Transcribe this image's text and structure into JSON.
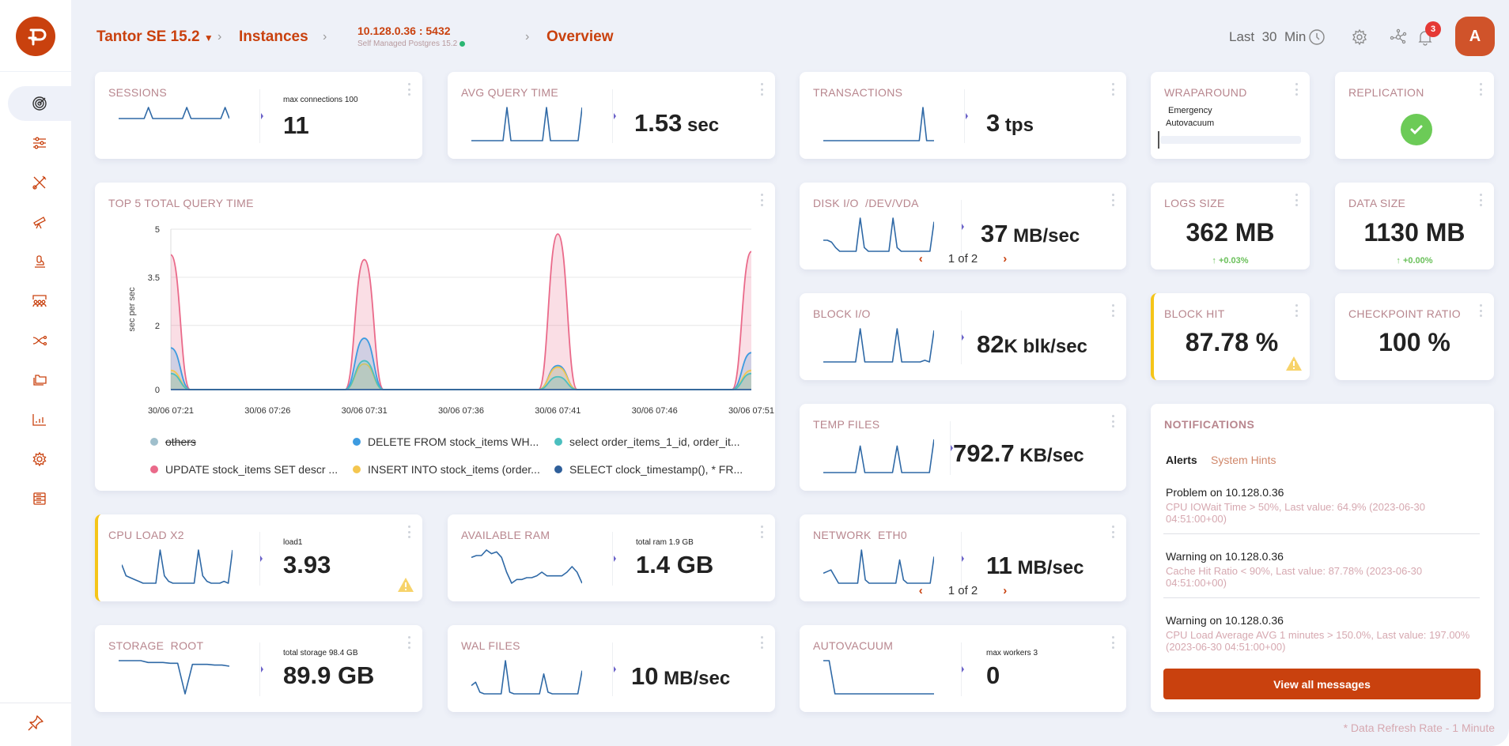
{
  "brand": {
    "logo": "tantor-logo",
    "color": "#C9410E"
  },
  "sidebar": {
    "items": [
      {
        "name": "overview",
        "icon": "radar-icon",
        "active": true
      },
      {
        "name": "configuration",
        "icon": "sliders-icon"
      },
      {
        "name": "tools",
        "icon": "tools-icon"
      },
      {
        "name": "monitoring",
        "icon": "telescope-icon"
      },
      {
        "name": "inspector",
        "icon": "microscope-icon"
      },
      {
        "name": "sessions",
        "icon": "users-icon"
      },
      {
        "name": "replication",
        "icon": "shuffle-icon"
      },
      {
        "name": "storage",
        "icon": "folder-icon"
      },
      {
        "name": "statistics",
        "icon": "bar-chart-icon"
      },
      {
        "name": "settings",
        "icon": "gear-icon"
      },
      {
        "name": "database",
        "icon": "database-icon"
      }
    ],
    "pin_icon": "pin-icon"
  },
  "header": {
    "product": "Tantor SE 15.2",
    "instances": "Instances",
    "instance_ip": "10.128.0.36 : 5432",
    "instance_sub": "Self Managed Postgres 15.2",
    "page": "Overview",
    "time_range_prefix": "Last",
    "time_range_value": "30",
    "time_range_unit": "Min",
    "notifications_count": "3",
    "avatar_initial": "A"
  },
  "cards": {
    "sessions": {
      "title": "SESSIONS",
      "sub": "max connections 100",
      "value": "11",
      "unit": ""
    },
    "avg_query": {
      "title": "AVG QUERY TIME",
      "value": "1.53",
      "unit": " sec"
    },
    "transactions": {
      "title": "TRANSACTIONS",
      "value": "3",
      "unit": " tps"
    },
    "wraparound": {
      "title": "WRAPAROUND",
      "label1": "Emergency",
      "label2": "Autovacuum",
      "progress": 0
    },
    "replication": {
      "title": "REPLICATION",
      "status": "ok"
    },
    "disk_io": {
      "title": "DISK I/O  /DEV/VDA",
      "value": "37",
      "unit": " MB/sec",
      "pager": "1 of 2"
    },
    "logs_size": {
      "title": "LOGS SIZE",
      "value": "362 MB",
      "delta": "↑  +0.03%"
    },
    "data_size": {
      "title": "DATA SIZE",
      "value": "1130 MB",
      "delta": "↑  +0.00%"
    },
    "block_io": {
      "title": "BLOCK I/O",
      "value": "82",
      "unit_k": "K",
      "unit": " blk/sec"
    },
    "block_hit": {
      "title": "BLOCK HIT",
      "value": "87.78 %",
      "warning": true
    },
    "checkpoint": {
      "title": "CHECKPOINT RATIO",
      "value": "100 %"
    },
    "temp_files": {
      "title": "TEMP FILES",
      "value": "792.7",
      "unit": " KB/sec"
    },
    "cpu_load": {
      "title": "CPU LOAD X2",
      "sub": "load1",
      "value": "3.93",
      "warning": true
    },
    "ram": {
      "title": "AVAILABLE RAM",
      "sub": "total ram 1.9 GB",
      "value": "1.4 GB"
    },
    "network": {
      "title": "NETWORK  ETH0",
      "value": "11",
      "unit": " MB/sec",
      "pager": "1 of 2"
    },
    "storage": {
      "title": "STORAGE  ROOT",
      "sub": "total storage 98.4 GB",
      "value": "89.9 GB"
    },
    "wal": {
      "title": "WAL FILES",
      "value": "10",
      "unit": " MB/sec"
    },
    "autovacuum": {
      "title": "AUTOVACUUM",
      "sub": "max workers 3",
      "value": "0"
    }
  },
  "pager_prev": "‹",
  "pager_next": "›",
  "sparklines": {
    "sessions": [
      4,
      4,
      4,
      4,
      4,
      4,
      4,
      6,
      4,
      4,
      4,
      4,
      4,
      4,
      4,
      4,
      6,
      4,
      4,
      4,
      4,
      4,
      4,
      4,
      4,
      6,
      4
    ],
    "avg_query": [
      0,
      0,
      0,
      0,
      0,
      0,
      0,
      0,
      0,
      10,
      0,
      0,
      0,
      0,
      0,
      0,
      0,
      0,
      0,
      10,
      0,
      0,
      0,
      0,
      0,
      0,
      0,
      0,
      10
    ],
    "transactions": [
      0,
      0,
      0,
      0,
      0,
      0,
      0,
      0,
      0,
      0,
      0,
      0,
      0,
      0,
      0,
      0,
      0,
      0,
      0,
      0,
      0,
      0,
      0,
      0,
      0,
      0,
      0,
      10,
      0,
      0,
      0
    ],
    "disk_io": [
      3,
      3,
      2.5,
      1,
      0,
      0,
      0,
      0,
      0,
      9,
      1,
      0,
      0,
      0,
      0,
      0,
      0,
      9,
      1,
      0,
      0,
      0,
      0,
      0,
      0,
      0,
      0,
      8
    ],
    "block_io": [
      0,
      0,
      0,
      0,
      0,
      0,
      0,
      0,
      10,
      0,
      0,
      0,
      0,
      0,
      0,
      0,
      10,
      0,
      0,
      0,
      0,
      0,
      0.5,
      0,
      9.5
    ],
    "temp_files": [
      0,
      0,
      0,
      0,
      0,
      0,
      0,
      0,
      8,
      0,
      0,
      0,
      0,
      0,
      0,
      0,
      8,
      0,
      0,
      0,
      0,
      0,
      0,
      0,
      10
    ],
    "cpu_load": [
      5,
      2,
      1.5,
      1,
      0.5,
      0,
      0,
      0,
      0,
      9,
      2,
      0.5,
      0,
      0,
      0,
      0,
      0,
      0,
      9,
      2,
      0.5,
      0,
      0,
      0,
      0.5,
      0,
      9
    ],
    "ram": [
      7,
      7.5,
      7.5,
      9,
      8,
      8.5,
      7,
      3,
      0,
      1,
      1,
      1.5,
      1.5,
      2,
      3,
      2,
      2,
      2,
      2,
      3,
      4.5,
      3,
      0
    ],
    "network": [
      3,
      3.5,
      4,
      2,
      0,
      0,
      0,
      0,
      0,
      0,
      10,
      1,
      0,
      0,
      0,
      0,
      0,
      0,
      0,
      0,
      7,
      1,
      0,
      0,
      0,
      0,
      0,
      0,
      0,
      8
    ],
    "storage": [
      9,
      9,
      9,
      9,
      8.5,
      8.5,
      8.5,
      8.3,
      8.3,
      0,
      8,
      8,
      8,
      7.8,
      7.8,
      7.5
    ],
    "wal": [
      2.5,
      3.5,
      0.5,
      0,
      0,
      0,
      0,
      0,
      10,
      0.5,
      0,
      0,
      0,
      0,
      0,
      0,
      0,
      6,
      0.5,
      0,
      0,
      0,
      0,
      0,
      0,
      0,
      7
    ],
    "autovacuum": [
      10,
      10,
      0,
      0,
      0,
      0,
      0,
      0,
      0,
      0,
      0,
      0,
      0,
      0,
      0,
      0,
      0,
      0,
      0,
      0
    ]
  },
  "chart_data": {
    "type": "area",
    "title": "TOP 5 TOTAL QUERY TIME",
    "xlabel": "",
    "ylabel": "sec per sec",
    "ylim": [
      0,
      5
    ],
    "yticks": [
      0,
      2,
      3.5,
      5
    ],
    "x": [
      "30/06 07:21",
      "30/06 07:22",
      "30/06 07:23",
      "30/06 07:24",
      "30/06 07:25",
      "30/06 07:26",
      "30/06 07:27",
      "30/06 07:28",
      "30/06 07:29",
      "30/06 07:30",
      "30/06 07:31",
      "30/06 07:32",
      "30/06 07:33",
      "30/06 07:34",
      "30/06 07:35",
      "30/06 07:36",
      "30/06 07:37",
      "30/06 07:38",
      "30/06 07:39",
      "30/06 07:40",
      "30/06 07:41",
      "30/06 07:42",
      "30/06 07:43",
      "30/06 07:44",
      "30/06 07:45",
      "30/06 07:46",
      "30/06 07:47",
      "30/06 07:48",
      "30/06 07:49",
      "30/06 07:50",
      "30/06 07:51"
    ],
    "xticks": [
      "30/06 07:21",
      "30/06 07:26",
      "30/06 07:31",
      "30/06 07:36",
      "30/06 07:41",
      "30/06 07:46",
      "30/06 07:51"
    ],
    "legend_position": "bottom",
    "series": [
      {
        "name": "others",
        "color": "#9fbfcc",
        "hidden": true,
        "values": [
          0,
          0,
          0,
          0,
          0,
          0,
          0,
          0,
          0,
          0,
          0,
          0,
          0,
          0,
          0,
          0,
          0,
          0,
          0,
          0,
          0,
          0,
          0,
          0,
          0,
          0,
          0,
          0,
          0,
          0,
          0
        ]
      },
      {
        "name": "DELETE FROM stock_items WH...",
        "color": "#3d9be0",
        "values": [
          1.3,
          0,
          0,
          0,
          0,
          0,
          0,
          0,
          0,
          0,
          1.6,
          0,
          0,
          0,
          0,
          0,
          0,
          0,
          0,
          0,
          0.75,
          0,
          0,
          0,
          0,
          0,
          0,
          0,
          0,
          0,
          1.15
        ]
      },
      {
        "name": "select order_items_1_id, order_it...",
        "color": "#4bbfbf",
        "values": [
          0.5,
          0,
          0,
          0,
          0,
          0,
          0,
          0,
          0,
          0,
          0.9,
          0,
          0,
          0,
          0,
          0,
          0,
          0,
          0,
          0,
          0.4,
          0,
          0,
          0,
          0,
          0,
          0,
          0,
          0,
          0,
          0.5
        ]
      },
      {
        "name": "UPDATE stock_items SET descr ...",
        "color": "#ea6a8a",
        "values": [
          4.2,
          0,
          0,
          0,
          0,
          0,
          0,
          0,
          0,
          0,
          4.05,
          0,
          0,
          0,
          0,
          0,
          0,
          0,
          0,
          0,
          4.85,
          0,
          0,
          0,
          0,
          0,
          0,
          0,
          0,
          0,
          4.3
        ]
      },
      {
        "name": "INSERT INTO stock_items (order...",
        "color": "#f4c64f",
        "values": [
          0.6,
          0,
          0,
          0,
          0,
          0,
          0,
          0,
          0,
          0,
          0.8,
          0,
          0,
          0,
          0,
          0,
          0,
          0,
          0,
          0,
          0.7,
          0,
          0,
          0,
          0,
          0,
          0,
          0,
          0,
          0,
          0.6
        ]
      },
      {
        "name": "SELECT clock_timestamp(), * FR...",
        "color": "#2f5f9a",
        "values": [
          0,
          0,
          0,
          0,
          0,
          0,
          0,
          0,
          0,
          0,
          0,
          0,
          0,
          0,
          0,
          0,
          0,
          0,
          0,
          0,
          0,
          0,
          0,
          0,
          0,
          0,
          0,
          0,
          0,
          0,
          0
        ]
      }
    ]
  },
  "notifications": {
    "title": "NOTIFICATIONS",
    "tabs": [
      "Alerts",
      "System Hints"
    ],
    "messages": [
      {
        "head": "Problem on 10.128.0.36",
        "body": "CPU IOWait Time > 50%, Last value: 64.9% (2023-06-30 04:51:00+00)"
      },
      {
        "head": "Warning on 10.128.0.36",
        "body": "Cache Hit Ratio < 90%, Last value: 87.78% (2023-06-30 04:51:00+00)"
      },
      {
        "head": "Warning on 10.128.0.36",
        "body": "CPU Load Average AVG 1 minutes > 150.0%, Last value: 197.00% (2023-06-30 04:51:00+00)"
      }
    ],
    "view_all": "View all messages"
  },
  "footer": {
    "refresh": "* Data Refresh Rate - 1 Minute"
  },
  "colors": {
    "accent": "#C9410E",
    "spark": "#2f69a6",
    "title": "#b8868e",
    "warning": "#f5c518",
    "ok": "#6ccb57"
  }
}
